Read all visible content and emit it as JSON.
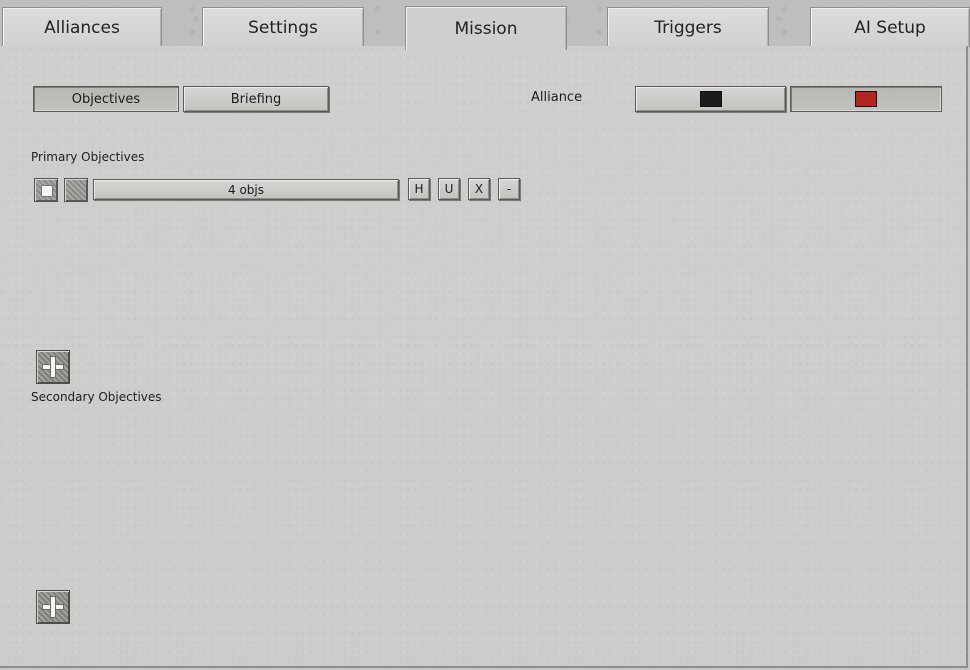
{
  "tabs": [
    {
      "label": "Alliances",
      "active": false
    },
    {
      "label": "Settings",
      "active": false
    },
    {
      "label": "Mission",
      "active": true
    },
    {
      "label": "Triggers",
      "active": false
    },
    {
      "label": "AI Setup",
      "active": false
    }
  ],
  "subtabs": {
    "objectives_label": "Objectives",
    "briefing_label": "Briefing",
    "selected": "Objectives"
  },
  "alliance": {
    "label": "Alliance",
    "options": [
      {
        "color": "#1c1c1c",
        "selected": false
      },
      {
        "color": "#b3261e",
        "selected": true
      }
    ]
  },
  "primary": {
    "heading": "Primary Objectives",
    "rows": [
      {
        "summary": "4 objs",
        "buttons": [
          "H",
          "U",
          "X",
          "-"
        ]
      }
    ]
  },
  "secondary": {
    "heading": "Secondary Objectives"
  },
  "icons": {
    "add": "plus-icon",
    "checkbox": "checkbox-icon",
    "grate": "grate-icon"
  }
}
